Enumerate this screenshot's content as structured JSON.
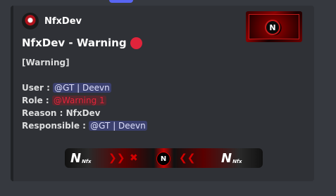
{
  "author": {
    "name": "NfxDev"
  },
  "title": "NfxDev - Warning",
  "description": {
    "type_line": "[Warning]",
    "user_label": "User :",
    "user_value": "@GT | Deevn",
    "role_label": "Role :",
    "role_value": "@Warning 1",
    "reason_label": "Reason :",
    "reason_value": "NfxDev",
    "responsible_label": "Responsible :",
    "responsible_value": "@GT | Deevn"
  },
  "colors": {
    "background": "#36393f",
    "embed_bg": "#2f3136",
    "accent_red": "#e0243b",
    "mention_bg": "#5865f2"
  },
  "icons": {
    "author_avatar": "nfx-logo-avatar",
    "title_emoji": "red-circle-icon",
    "thumbnail": "nfx-banner-thumbnail",
    "image": "nfx-banner-image"
  }
}
